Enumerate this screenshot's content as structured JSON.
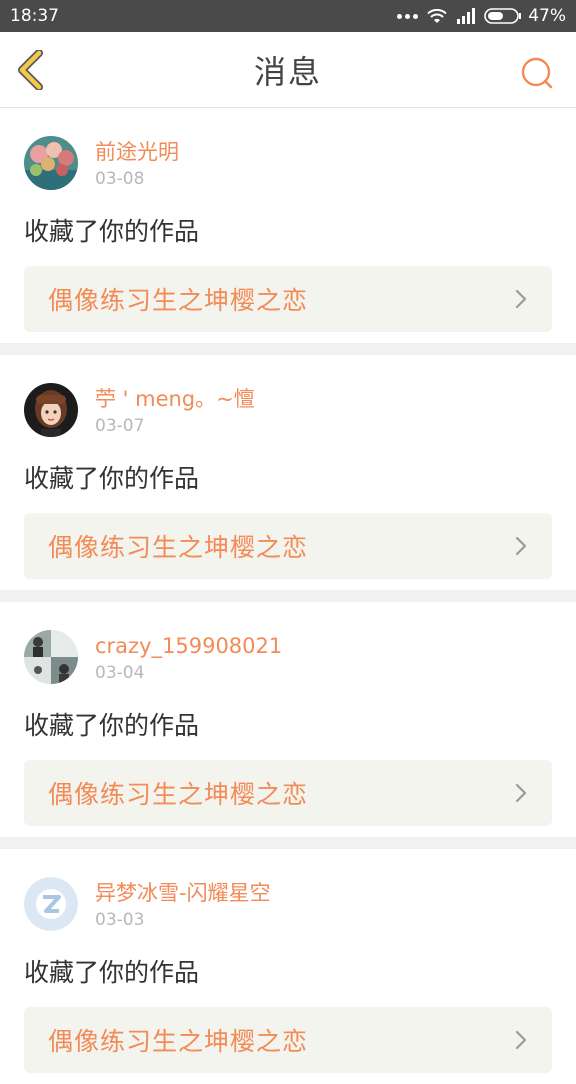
{
  "status": {
    "time": "18:37",
    "battery": "47%"
  },
  "header": {
    "title": "消息"
  },
  "colors": {
    "accent": "#f28b57",
    "back_arrow": "#f5c84a"
  },
  "messages": [
    {
      "username": "前途光明",
      "date": "03-08",
      "action": "收藏了你的作品",
      "work": "偶像练习生之坤樱之恋"
    },
    {
      "username": "苧 ' meng。~憻",
      "date": "03-07",
      "action": "收藏了你的作品",
      "work": "偶像练习生之坤樱之恋"
    },
    {
      "username": "crazy_159908021",
      "date": "03-04",
      "action": "收藏了你的作品",
      "work": "偶像练习生之坤樱之恋"
    },
    {
      "username": "异梦冰雪-闪耀星空",
      "date": "03-03",
      "action": "收藏了你的作品",
      "work": "偶像练习生之坤樱之恋"
    }
  ]
}
